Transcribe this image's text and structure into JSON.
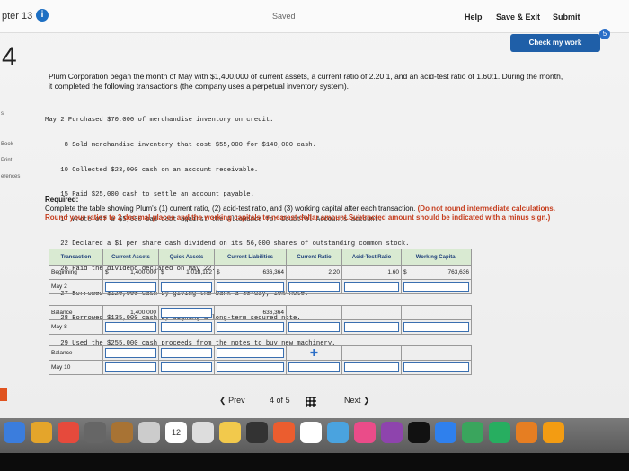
{
  "topbar": {
    "chapter": "pter 13",
    "info_icon": "info-icon",
    "saved": "Saved",
    "help": "Help",
    "save_exit": "Save & Exit",
    "submit": "Submit"
  },
  "check_work": "Check my work",
  "badge": "5",
  "question_number": "4",
  "left_items": [
    "s",
    "Book",
    "Print",
    "erences"
  ],
  "intro": "Plum Corporation began the month of May with $1,400,000 of current assets, a current ratio of 2.20:1, and an acid-test ratio of 1.60:1. During the month, it completed the following transactions (the company uses a perpetual inventory system).",
  "transactions": [
    "May 2 Purchased $70,000 of merchandise inventory on credit.",
    "     8 Sold merchandise inventory that cost $55,000 for $140,000 cash.",
    "    10 Collected $23,000 cash on an account receivable.",
    "    15 Paid $25,000 cash to settle an account payable.",
    "    17 Wrote off a $5,000 bad debt against the Allowance for Doubtful Accounts account.",
    "    22 Declared a $1 per share cash dividend on its 56,000 shares of outstanding common stock.",
    "    26 Paid the dividend declared on May 22.",
    "    27 Borrowed $120,000 cash by giving the bank a 30-day, 10% note.",
    "    28 Borrowed $135,000 cash by signing a long-term secured note.",
    "    29 Used the $255,000 cash proceeds from the notes to buy new machinery."
  ],
  "required_head": "Required:",
  "required_text": "Complete the table showing Plum's (1) current ratio, (2) acid-test ratio, and (3) working capital after each transaction.",
  "required_red": "(Do not round intermediate calculations. Round your ratios to 2 decimal places and the working capitals to nearest dollar amount.Subtracted amount should be indicated with a minus sign.)",
  "table": {
    "headers": [
      "Transaction",
      "Current Assets",
      "Quick Assets",
      "Current Liabilities",
      "Current Ratio",
      "Acid-Test Ratio",
      "Working Capital"
    ],
    "beginning": [
      "Beginning",
      "$",
      "1,400,000",
      "$",
      "1,018,182",
      "$",
      "636,364",
      "2.20",
      "1.60",
      "$",
      "763,636"
    ],
    "may2": "May 2",
    "balance1_label": "Balance",
    "balance1_ca": "1,400,000",
    "balance1_cl": "636,364",
    "may8": "May 8",
    "balance2_label": "Balance",
    "may10": "May 10"
  },
  "nav": {
    "prev": "Prev",
    "page": "4",
    "of": "of",
    "total": "5",
    "next": "Next"
  },
  "dock_badge": "12"
}
